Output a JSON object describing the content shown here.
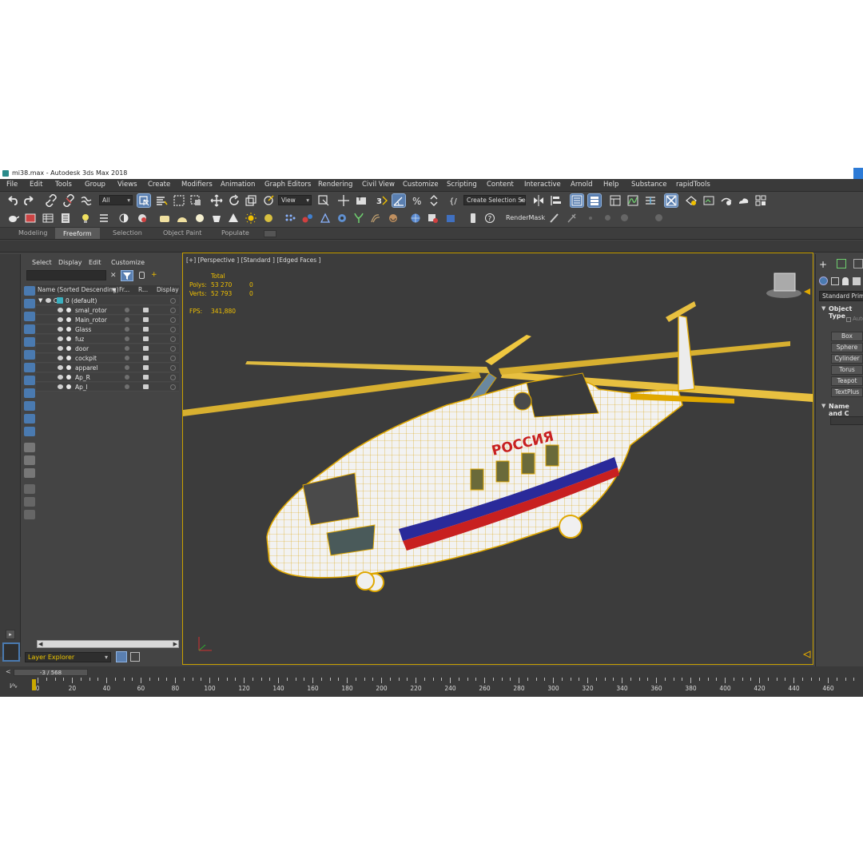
{
  "window": {
    "title": "mi38.max - Autodesk 3ds Max 2018"
  },
  "menu": [
    "File",
    "Edit",
    "Tools",
    "Group",
    "Views",
    "Create",
    "Modifiers",
    "Animation",
    "Graph Editors",
    "Rendering",
    "Civil View",
    "Customize",
    "Scripting",
    "Content",
    "Interactive",
    "Arnold",
    "Help",
    "Substance",
    "rapidTools"
  ],
  "toolbar": {
    "selection_filter": "All",
    "ref_coord": "View",
    "selection_set": "Create Selection Se",
    "render_mask": "RenderMask"
  },
  "ribbon_tabs": [
    "Modeling",
    "Freeform",
    "Selection",
    "Object Paint",
    "Populate"
  ],
  "ribbon_active": "Freeform",
  "explorer": {
    "menu": [
      "Select",
      "Display",
      "Edit",
      "Customize"
    ],
    "columns": {
      "name": "Name (Sorted Descending)",
      "frozen": "Fr...",
      "render": "R...",
      "display": "Display a"
    },
    "root": "0 (default)",
    "items": [
      "smal_rotor",
      "Main_rotor",
      "Glass",
      "fuz",
      "door",
      "cockpit",
      "apparel",
      "Ap_R",
      "Ap_l"
    ],
    "layer_dropdown": "Layer Explorer"
  },
  "viewport": {
    "label": "[+] [Perspective ] [Standard ] [Edged Faces ]",
    "stats": {
      "header": "Total",
      "polys_label": "Polys:",
      "polys_total": "53 270",
      "polys_sel": "0",
      "verts_label": "Verts:",
      "verts_total": "52 793",
      "verts_sel": "0",
      "fps_label": "FPS:",
      "fps_value": "341,880"
    },
    "fuselage_text": "РОССИЯ"
  },
  "command_panel": {
    "category": "Standard Primitiv",
    "rollout_object_type": "Object Type",
    "autogrid": "AutoGrid",
    "buttons": [
      "Box",
      "Sphere",
      "Cylinder",
      "Torus",
      "Teapot",
      "TextPlus"
    ],
    "rollout_name_color": "Name and C"
  },
  "timeline": {
    "frame": "-3 / 568",
    "labels": [
      "0",
      "20",
      "40",
      "60",
      "80",
      "100",
      "120",
      "140",
      "160",
      "180",
      "200",
      "220",
      "240",
      "260",
      "280",
      "300",
      "320",
      "340",
      "360",
      "380",
      "400",
      "420",
      "440",
      "460"
    ]
  },
  "colors": {
    "accent": "#c9a100",
    "selected": "#5a7fb0",
    "wire": "#e0a800"
  }
}
